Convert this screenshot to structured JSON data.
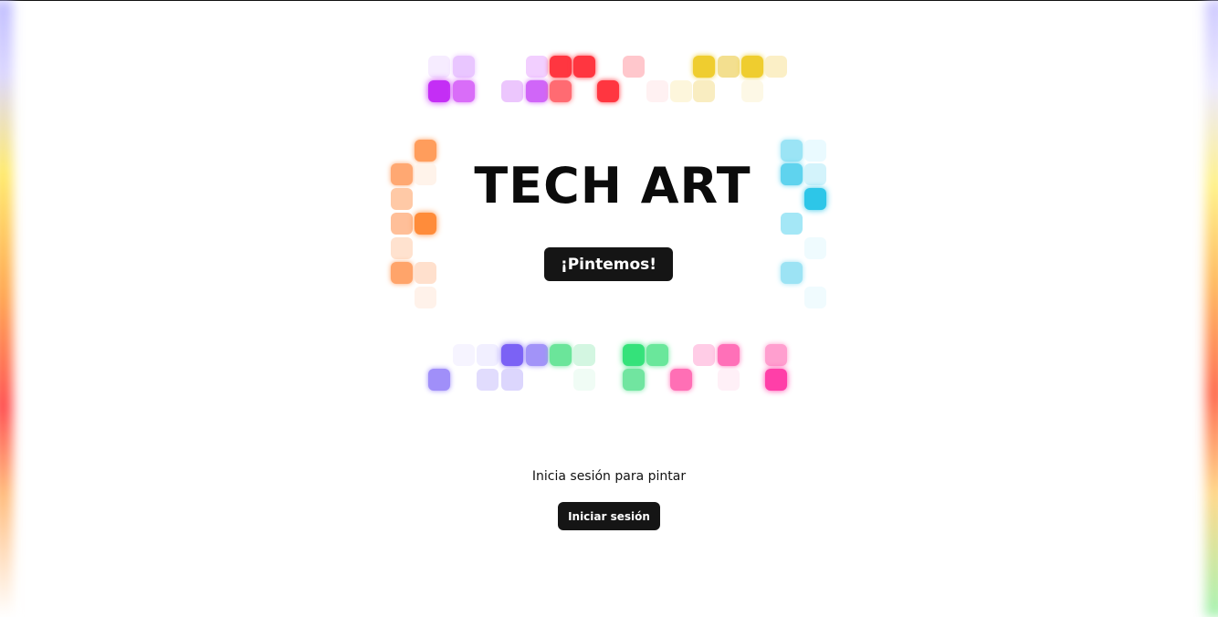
{
  "hero": {
    "title": "TECH ART",
    "cta_label": "¡Pintemos!"
  },
  "login": {
    "prompt": "Inicia sesión para pintar",
    "button_label": "Iniciar sesión"
  },
  "theme": {
    "button_bg": "#151515",
    "button_text": "#ffffff",
    "text_color": "#0b0b0b",
    "palette": {
      "purple": "#c42ef5",
      "red": "#ff3640",
      "pink_light": "#ffc7cc",
      "yellow": "#efcd2f",
      "orange": "#ff8c3a",
      "cyan": "#2dc6e8",
      "violet": "#7b62f5",
      "green": "#34e27a",
      "pink": "#ff3fa8"
    }
  }
}
